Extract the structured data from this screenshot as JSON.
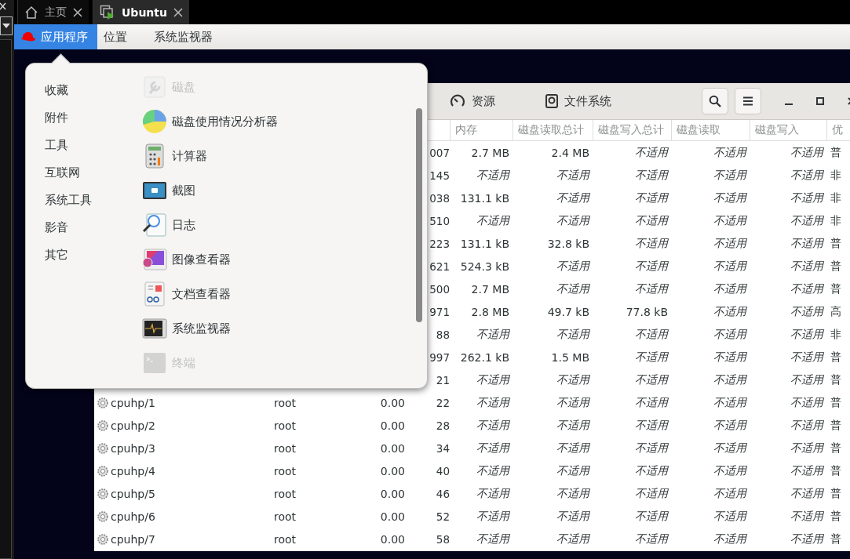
{
  "vm_tabs": [
    {
      "label": "主页",
      "selected": false
    },
    {
      "label": "Ubuntu",
      "selected": true
    }
  ],
  "top_bar": {
    "items": [
      {
        "label": "应用程序",
        "selected": true
      },
      {
        "label": "位置",
        "selected": false
      },
      {
        "label": "系统监视器",
        "selected": false
      }
    ]
  },
  "app_menu": {
    "categories": [
      "收藏",
      "附件",
      "工具",
      "互联网",
      "系统工具",
      "影音",
      "其它"
    ],
    "apps": [
      {
        "label": "磁盘",
        "disabled": true
      },
      {
        "label": "磁盘使用情况分析器",
        "disabled": false
      },
      {
        "label": "计算器",
        "disabled": false
      },
      {
        "label": "截图",
        "disabled": false
      },
      {
        "label": "日志",
        "disabled": false
      },
      {
        "label": "图像查看器",
        "disabled": false
      },
      {
        "label": "文档查看器",
        "disabled": false
      },
      {
        "label": "系统监视器",
        "disabled": false
      },
      {
        "label": "终端",
        "disabled": true
      }
    ]
  },
  "system_monitor": {
    "tabs": [
      {
        "label": "资源"
      },
      {
        "label": "文件系统"
      }
    ],
    "columns": [
      "内存",
      "磁盘读取总计",
      "磁盘写入总计",
      "磁盘读取",
      "磁盘写入",
      "优"
    ],
    "rows": [
      {
        "pid": "007",
        "values": [
          "2.7 MB",
          "2.4 MB",
          "不适用",
          "不适用",
          "不适用"
        ],
        "italic": [
          false,
          false,
          true,
          true,
          true
        ],
        "priority": "普"
      },
      {
        "pid": "145",
        "values": [
          "不适用",
          "不适用",
          "不适用",
          "不适用",
          "不适用"
        ],
        "italic": [
          true,
          true,
          true,
          true,
          true
        ],
        "priority": "非"
      },
      {
        "pid": "038",
        "values": [
          "131.1 kB",
          "不适用",
          "不适用",
          "不适用",
          "不适用"
        ],
        "italic": [
          false,
          true,
          true,
          true,
          true
        ],
        "priority": "非"
      },
      {
        "pid": "510",
        "values": [
          "不适用",
          "不适用",
          "不适用",
          "不适用",
          "不适用"
        ],
        "italic": [
          true,
          true,
          true,
          true,
          true
        ],
        "priority": "非"
      },
      {
        "pid": "223",
        "values": [
          "131.1 kB",
          "32.8 kB",
          "不适用",
          "不适用",
          "不适用"
        ],
        "italic": [
          false,
          false,
          true,
          true,
          true
        ],
        "priority": "普"
      },
      {
        "pid": "621",
        "values": [
          "524.3 kB",
          "不适用",
          "不适用",
          "不适用",
          "不适用"
        ],
        "italic": [
          false,
          true,
          true,
          true,
          true
        ],
        "priority": "普"
      },
      {
        "pid": "500",
        "values": [
          "2.7 MB",
          "不适用",
          "不适用",
          "不适用",
          "不适用"
        ],
        "italic": [
          false,
          true,
          true,
          true,
          true
        ],
        "priority": "普"
      },
      {
        "pid": "971",
        "values": [
          "2.8 MB",
          "49.7 kB",
          "77.8 kB",
          "不适用",
          "不适用"
        ],
        "italic": [
          false,
          false,
          false,
          true,
          true
        ],
        "priority": "高"
      },
      {
        "pid": "88",
        "values": [
          "不适用",
          "不适用",
          "不适用",
          "不适用",
          "不适用"
        ],
        "italic": [
          true,
          true,
          true,
          true,
          true
        ],
        "priority": "非"
      },
      {
        "pid": "997",
        "values": [
          "262.1 kB",
          "1.5 MB",
          "不适用",
          "不适用",
          "不适用"
        ],
        "italic": [
          false,
          false,
          true,
          true,
          true
        ],
        "priority": "普"
      },
      {
        "pid": "21",
        "values": [
          "不适用",
          "不适用",
          "不适用",
          "不适用",
          "不适用"
        ],
        "italic": [
          true,
          true,
          true,
          true,
          true
        ],
        "priority": "普"
      },
      {
        "name": "cpuhp/1",
        "user": "root",
        "cpu": "0.00",
        "pid": "22",
        "values": [
          "不适用",
          "不适用",
          "不适用",
          "不适用",
          "不适用"
        ],
        "italic": [
          true,
          true,
          true,
          true,
          true
        ],
        "priority": "普"
      },
      {
        "name": "cpuhp/2",
        "user": "root",
        "cpu": "0.00",
        "pid": "28",
        "values": [
          "不适用",
          "不适用",
          "不适用",
          "不适用",
          "不适用"
        ],
        "italic": [
          true,
          true,
          true,
          true,
          true
        ],
        "priority": "普"
      },
      {
        "name": "cpuhp/3",
        "user": "root",
        "cpu": "0.00",
        "pid": "34",
        "values": [
          "不适用",
          "不适用",
          "不适用",
          "不适用",
          "不适用"
        ],
        "italic": [
          true,
          true,
          true,
          true,
          true
        ],
        "priority": "普"
      },
      {
        "name": "cpuhp/4",
        "user": "root",
        "cpu": "0.00",
        "pid": "40",
        "values": [
          "不适用",
          "不适用",
          "不适用",
          "不适用",
          "不适用"
        ],
        "italic": [
          true,
          true,
          true,
          true,
          true
        ],
        "priority": "普"
      },
      {
        "name": "cpuhp/5",
        "user": "root",
        "cpu": "0.00",
        "pid": "46",
        "values": [
          "不适用",
          "不适用",
          "不适用",
          "不适用",
          "不适用"
        ],
        "italic": [
          true,
          true,
          true,
          true,
          true
        ],
        "priority": "普"
      },
      {
        "name": "cpuhp/6",
        "user": "root",
        "cpu": "0.00",
        "pid": "52",
        "values": [
          "不适用",
          "不适用",
          "不适用",
          "不适用",
          "不适用"
        ],
        "italic": [
          true,
          true,
          true,
          true,
          true
        ],
        "priority": "普"
      },
      {
        "name": "cpuhp/7",
        "user": "root",
        "cpu": "0.00",
        "pid": "58",
        "values": [
          "不适用",
          "不适用",
          "不适用",
          "不适用",
          "不适用"
        ],
        "italic": [
          true,
          true,
          true,
          true,
          true
        ],
        "priority": "普"
      }
    ]
  }
}
